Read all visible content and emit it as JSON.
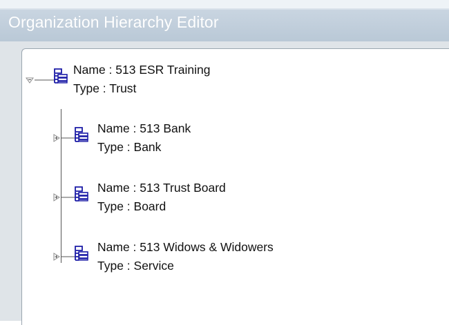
{
  "window": {
    "title": "Organization Hierarchy Editor"
  },
  "tree": {
    "root": {
      "name_label": "Name : 513 ESR Training",
      "type_label": "Type  : Trust",
      "expanded": true,
      "icon": "org-hierarchy-icon"
    },
    "children": [
      {
        "name_label": "Name : 513 Bank",
        "type_label": "Type  : Bank",
        "expanded": false,
        "icon": "org-hierarchy-icon"
      },
      {
        "name_label": "Name : 513 Trust Board",
        "type_label": "Type  : Board",
        "expanded": false,
        "icon": "org-hierarchy-icon"
      },
      {
        "name_label": "Name : 513 Widows & Widowers",
        "type_label": "Type  : Service",
        "expanded": false,
        "icon": "org-hierarchy-icon"
      }
    ]
  },
  "colors": {
    "icon": "#1a1aa6",
    "title_text": "#ffffff",
    "title_bar": "#bccad8"
  }
}
